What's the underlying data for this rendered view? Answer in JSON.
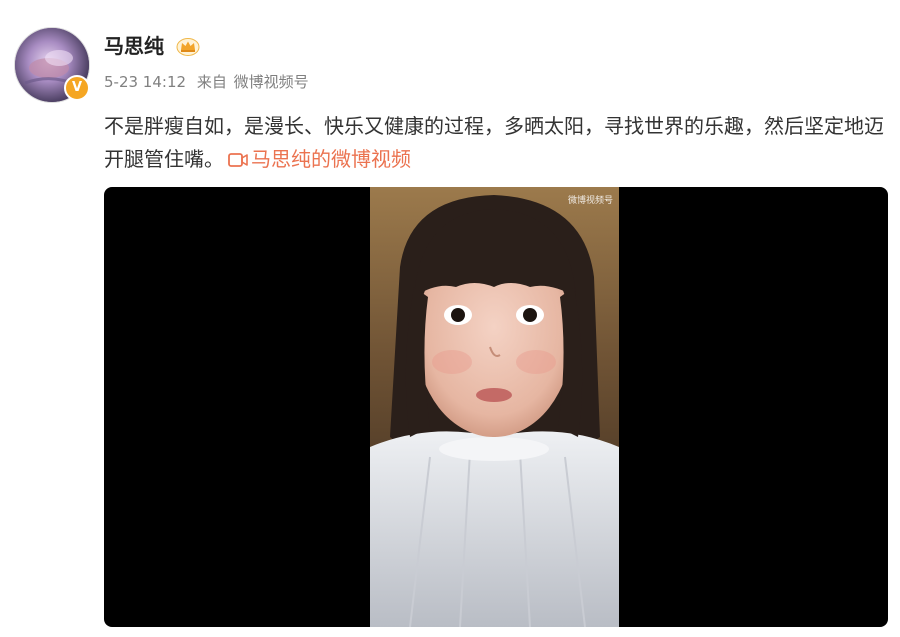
{
  "user": {
    "name": "马思纯",
    "verified_badge": "V",
    "member_icon": "crown-icon"
  },
  "meta": {
    "time": "5-23 14:12",
    "from_label": "来自",
    "source": "微博视频号"
  },
  "post": {
    "text": "不是胖瘦自如，是漫长、快乐又健康的过程，多晒太阳，寻找世界的乐趣，然后坚定地迈开腿管住嘴。",
    "video_link_label": "马思纯的微博视频"
  },
  "video": {
    "watermark": "微博视频号"
  },
  "colors": {
    "link": "#eb7350",
    "meta": "#808080",
    "badge": "#f5a623",
    "text": "#333333"
  }
}
